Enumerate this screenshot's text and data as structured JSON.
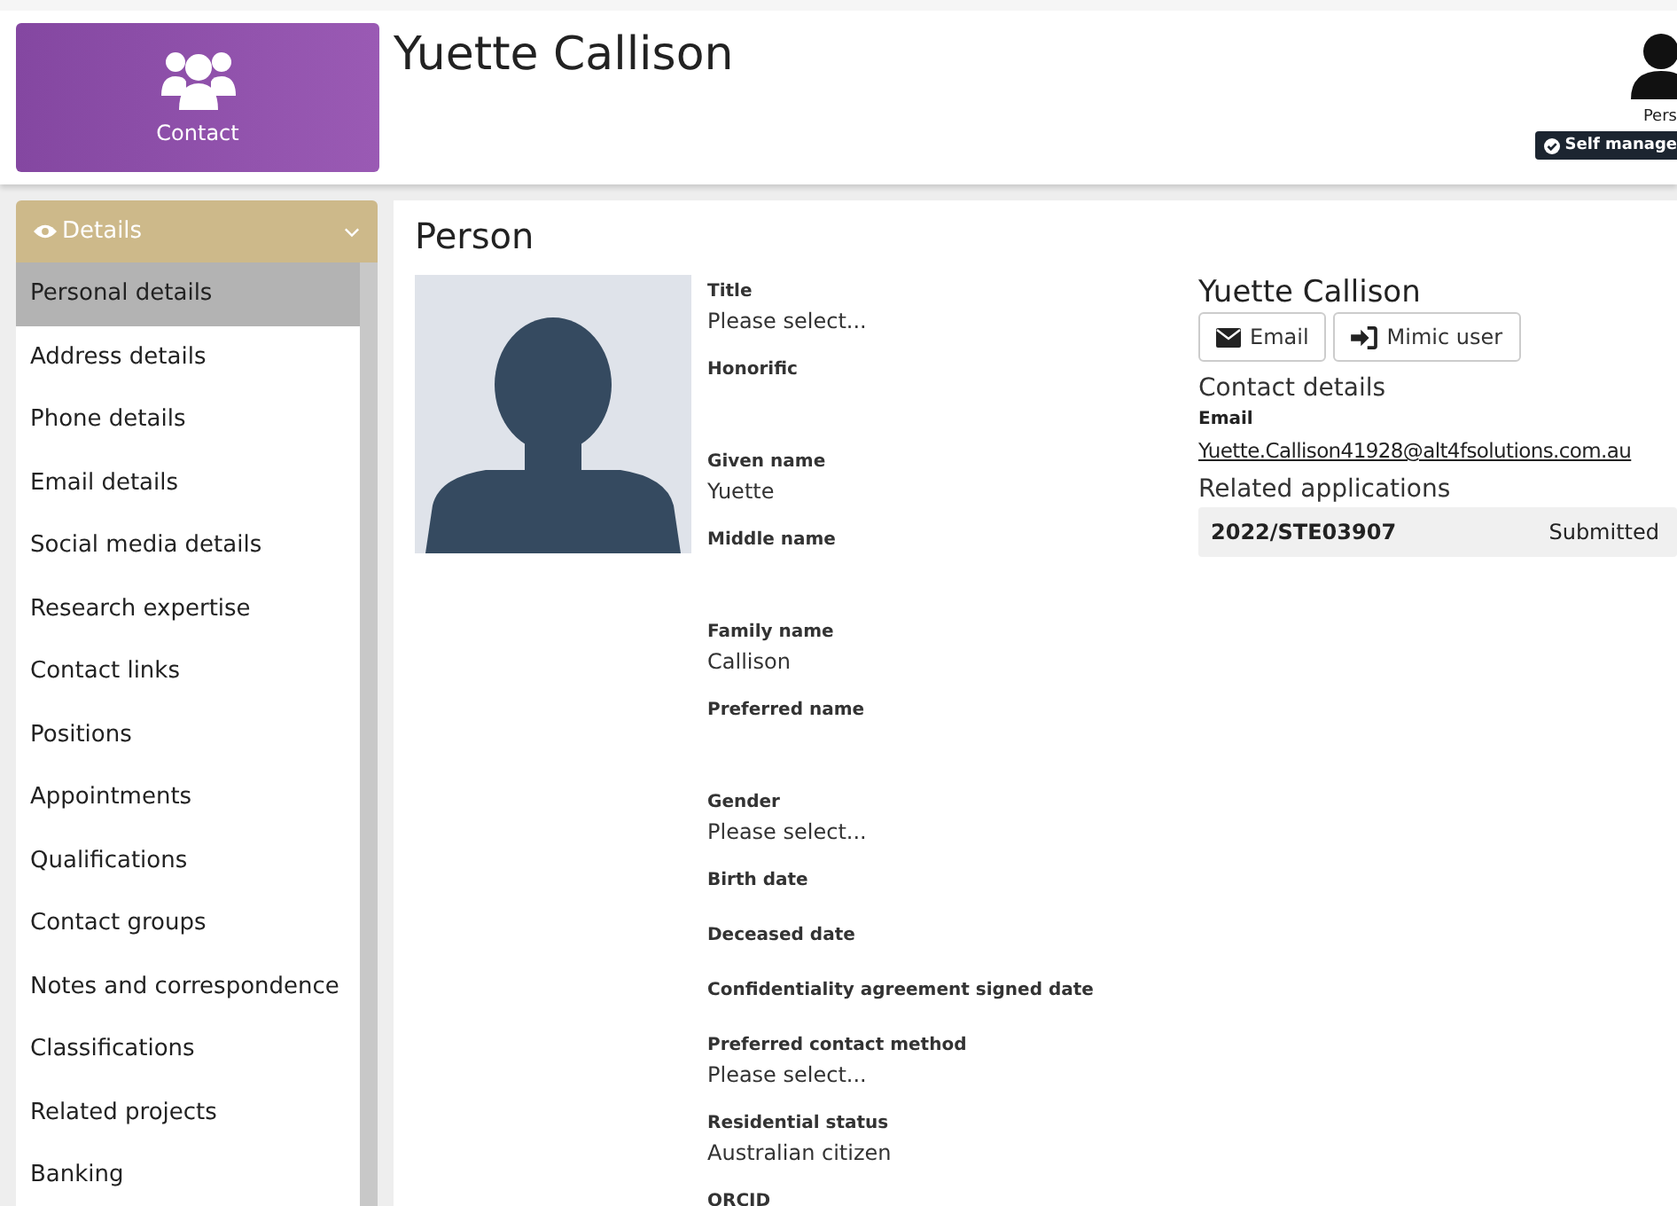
{
  "module_tile": {
    "label": "Contact"
  },
  "header": {
    "name": "Yuette Callison",
    "user_label": "Pers",
    "badge": "Self manage"
  },
  "sidebar": {
    "section": "Details",
    "expanded": true,
    "items": [
      {
        "label": "Personal details",
        "selected": true
      },
      {
        "label": "Address details",
        "selected": false
      },
      {
        "label": "Phone details",
        "selected": false
      },
      {
        "label": "Email details",
        "selected": false
      },
      {
        "label": "Social media details",
        "selected": false
      },
      {
        "label": "Research expertise",
        "selected": false
      },
      {
        "label": "Contact links",
        "selected": false
      },
      {
        "label": "Positions",
        "selected": false
      },
      {
        "label": "Appointments",
        "selected": false
      },
      {
        "label": "Qualifications",
        "selected": false
      },
      {
        "label": "Contact groups",
        "selected": false
      },
      {
        "label": "Notes and correspondence",
        "selected": false
      },
      {
        "label": "Classifications",
        "selected": false
      },
      {
        "label": "Related projects",
        "selected": false
      },
      {
        "label": "Banking",
        "selected": false
      }
    ]
  },
  "person": {
    "heading": "Person",
    "fields": [
      {
        "label": "Title",
        "kind": "select",
        "value": "Please select..."
      },
      {
        "label": "Honorific",
        "kind": "text"
      },
      {
        "label": "Given name",
        "kind": "text",
        "value": "Yuette"
      },
      {
        "label": "Middle name",
        "kind": "text"
      },
      {
        "label": "Family name",
        "kind": "text",
        "value": "Callison"
      },
      {
        "label": "Preferred name",
        "kind": "text"
      },
      {
        "label": "Gender",
        "kind": "select",
        "value": "Please select..."
      },
      {
        "label": "Birth date",
        "kind": "date"
      },
      {
        "label": "Deceased date",
        "kind": "date"
      },
      {
        "label": "Confidentiality agreement signed date",
        "kind": "date"
      },
      {
        "label": "Preferred contact method",
        "kind": "select",
        "value": "Please select..."
      },
      {
        "label": "Residential status",
        "kind": "select",
        "value": "Australian citizen"
      },
      {
        "label": "ORCID",
        "kind": "text"
      }
    ]
  },
  "summary": {
    "name": "Yuette Callison",
    "buttons": [
      {
        "label": "Email",
        "kind": "email"
      },
      {
        "label": "Mimic user",
        "kind": "login"
      }
    ],
    "contact_heading": "Contact details",
    "email_label": "Email",
    "email": "Yuette.Callison41928@alt4fsolutions.com.au",
    "related_heading": "Related applications",
    "applications": [
      {
        "id": "2022/STE03907",
        "status": "Submitted"
      }
    ]
  }
}
